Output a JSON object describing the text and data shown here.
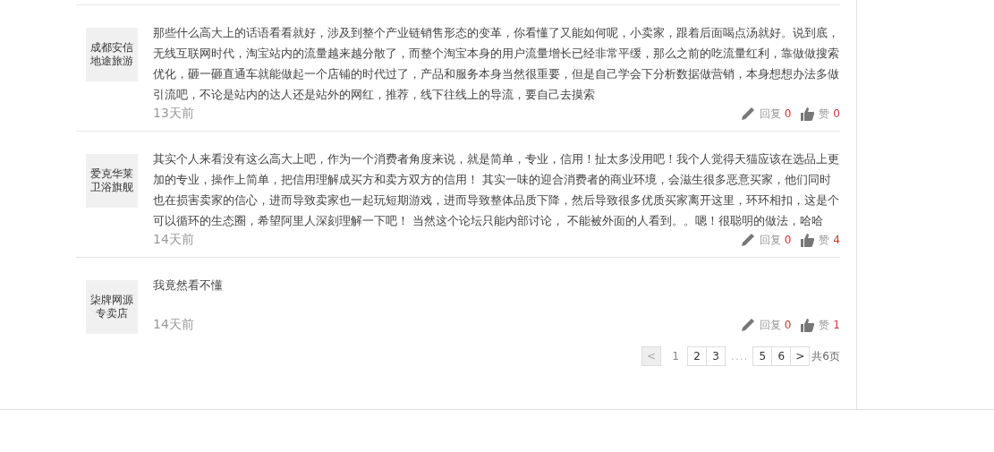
{
  "comments": [
    {
      "author": "成都安信地途旅游",
      "text": "那些什么高大上的话语看看就好，涉及到整个产业链销售形态的变革，你看懂了又能如何呢，小卖家，跟着后面喝点汤就好。说到底，无线互联网时代，淘宝站内的流量越来越分散了，而整个淘宝本身的用户流量增长已经非常平缓，那么之前的吃流量红利，靠做做搜索优化，砸一砸直通车就能做起一个店铺的时代过了，产品和服务本身当然很重要，但是自己学会下分析数据做营销，本身想想办法多做引流吧，不论是站内的达人还是站外的网红，推荐，线下往线上的导流，要自己去摸索",
      "time": "13天前",
      "reply_label": "回复",
      "reply_count": "0",
      "like_label": "赞",
      "like_count": "0"
    },
    {
      "author": "爱克华莱卫浴旗舰",
      "text": "其实个人来看没有这么高大上吧，作为一个消费者角度来说，就是简单，专业，信用！扯太多没用吧！我个人觉得天猫应该在选品上更加的专业，操作上简单，把信用理解成买方和卖方双方的信用！ 其实一味的迎合消费者的商业环境，会滋生很多恶意买家，他们同时也在损害卖家的信心，进而导致卖家也一起玩短期游戏，进而导致整体品质下降，然后导致很多优质买家离开这里，环环相扣，这是个可以循环的生态圈，希望阿里人深刻理解一下吧！ 当然这个论坛只能内部讨论， 不能被外面的人看到。。嗯！很聪明的做法，哈哈",
      "time": "14天前",
      "reply_label": "回复",
      "reply_count": "0",
      "like_label": "赞",
      "like_count": "4"
    },
    {
      "author": "柒牌网源专卖店",
      "text": "我竟然看不懂",
      "time": "14天前",
      "reply_label": "回复",
      "reply_count": "0",
      "like_label": "赞",
      "like_count": "1"
    }
  ],
  "pagination": {
    "items": [
      {
        "kind": "prev",
        "label": "<",
        "disabled": true
      },
      {
        "kind": "page",
        "label": "1",
        "selected": true
      },
      {
        "kind": "page",
        "label": "2",
        "selected": false
      },
      {
        "kind": "page",
        "label": "3",
        "selected": false
      },
      {
        "kind": "gap",
        "label": "...."
      },
      {
        "kind": "page",
        "label": "5",
        "selected": false
      },
      {
        "kind": "page",
        "label": "6",
        "selected": false
      },
      {
        "kind": "next",
        "label": ">",
        "disabled": false
      }
    ],
    "total": "共6页"
  }
}
